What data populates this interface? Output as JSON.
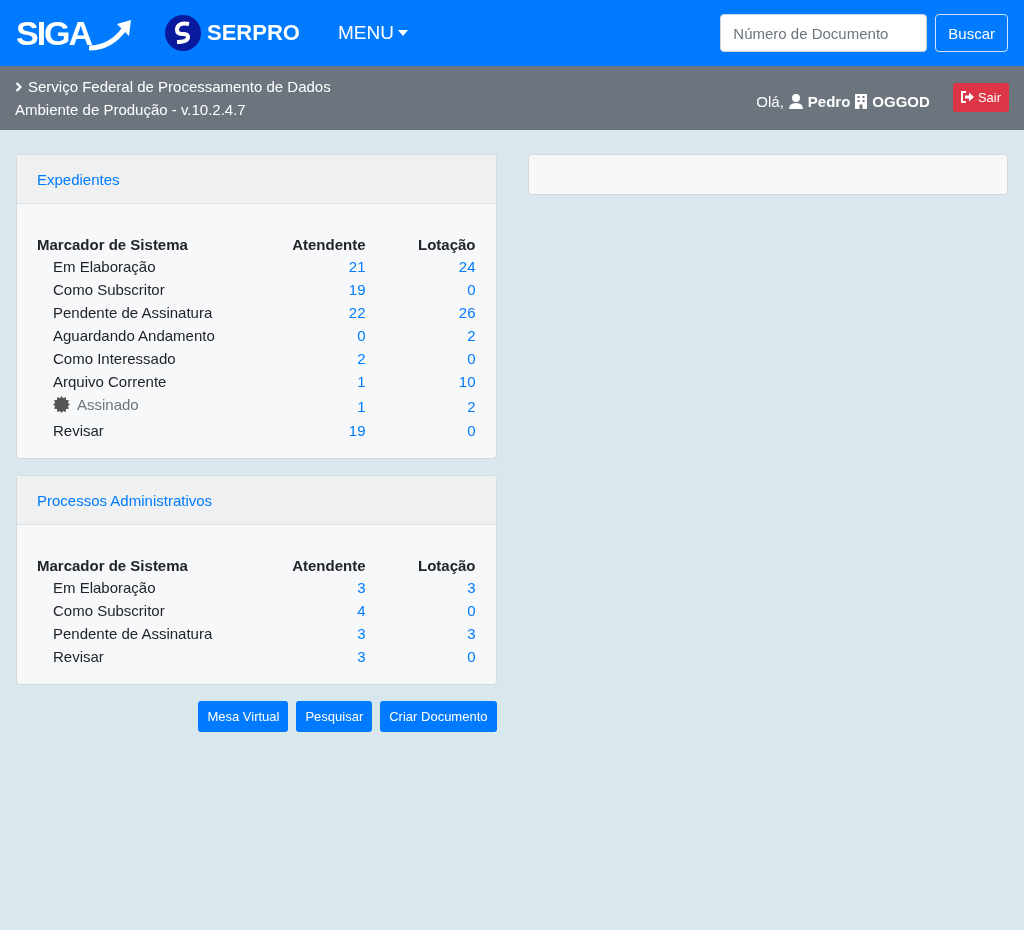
{
  "navbar": {
    "logo": "SIGA",
    "brand": "SERPRO",
    "menu": "MENU",
    "search": {
      "placeholder": "Número de Documento"
    },
    "search_button": "Buscar"
  },
  "subbar": {
    "breadcrumb": "Serviço Federal de Processamento de Dados",
    "environment": "Ambiente de Produção - v.10.2.4.7",
    "greeting": "Olá,",
    "user": "Pedro",
    "unit": "OGGOD",
    "logout": "Sair"
  },
  "panels": [
    {
      "title": "Expedientes",
      "columns": [
        "Marcador de Sistema",
        "Atendente",
        "Lotação"
      ],
      "rows": [
        {
          "kind": "plain",
          "label": "Em Elaboração",
          "atendente": "21",
          "lotacao": "24"
        },
        {
          "kind": "plain",
          "label": "Como Subscritor",
          "atendente": "19",
          "lotacao": "0"
        },
        {
          "kind": "plain",
          "label": "Pendente de Assinatura",
          "atendente": "22",
          "lotacao": "26"
        },
        {
          "kind": "plain",
          "label": "Aguardando Andamento",
          "atendente": "0",
          "lotacao": "2"
        },
        {
          "kind": "plain",
          "label": "Como Interessado",
          "atendente": "2",
          "lotacao": "0"
        },
        {
          "kind": "plain",
          "label": "Arquivo Corrente",
          "atendente": "1",
          "lotacao": "10"
        },
        {
          "kind": "seal",
          "label": "Assinado",
          "atendente": "1",
          "lotacao": "2"
        },
        {
          "kind": "plain",
          "label": "Revisar",
          "atendente": "19",
          "lotacao": "0"
        }
      ]
    },
    {
      "title": "Processos Administrativos",
      "columns": [
        "Marcador de Sistema",
        "Atendente",
        "Lotação"
      ],
      "rows": [
        {
          "kind": "plain",
          "label": "Em Elaboração",
          "atendente": "3",
          "lotacao": "3"
        },
        {
          "kind": "plain",
          "label": "Como Subscritor",
          "atendente": "4",
          "lotacao": "0"
        },
        {
          "kind": "plain",
          "label": "Pendente de Assinatura",
          "atendente": "3",
          "lotacao": "3"
        },
        {
          "kind": "plain",
          "label": "Revisar",
          "atendente": "3",
          "lotacao": "0"
        }
      ]
    }
  ],
  "actions": [
    "Mesa Virtual",
    "Pesquisar",
    "Criar Documento"
  ]
}
